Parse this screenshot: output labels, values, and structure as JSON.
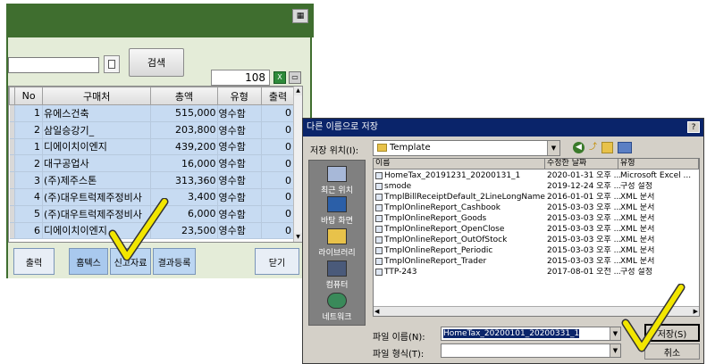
{
  "app": {
    "search_button": "검색",
    "record_count": "108",
    "grid": {
      "headers": [
        "No",
        "구매처",
        "총액",
        "유형",
        "출력"
      ],
      "rows": [
        {
          "no": "1",
          "name": "유에스건축",
          "amount": "515,000",
          "type": "영수함",
          "out": "0"
        },
        {
          "no": "2",
          "name": "삼일승강기_",
          "amount": "203,800",
          "type": "영수함",
          "out": "0"
        },
        {
          "no": "1",
          "name": "디에이치이엔지",
          "amount": "439,200",
          "type": "영수함",
          "out": "0"
        },
        {
          "no": "2",
          "name": "대구공업사",
          "amount": "16,000",
          "type": "영수함",
          "out": "0"
        },
        {
          "no": "3",
          "name": "(주)제주스톤",
          "amount": "313,360",
          "type": "영수함",
          "out": "0"
        },
        {
          "no": "4",
          "name": "(주)대우트럭제주정비사",
          "amount": "3,400",
          "type": "영수함",
          "out": "0"
        },
        {
          "no": "5",
          "name": "(주)대우트럭제주정비사",
          "amount": "6,000",
          "type": "영수함",
          "out": "0"
        },
        {
          "no": "6",
          "name": "디에이치이엔지",
          "amount": "23,500",
          "type": "영수함",
          "out": "0"
        }
      ]
    },
    "buttons": {
      "print": "출력",
      "hometax": "홈텍스",
      "report": "신고자료",
      "result": "결과등록",
      "close": "닫기"
    }
  },
  "dialog": {
    "title": "다른 이름으로 저장",
    "save_in_label": "저장 위치(I):",
    "save_in_value": "Template",
    "places": [
      "최근 위치",
      "바탕 화면",
      "라이브러리",
      "컴퓨터",
      "네트워크"
    ],
    "columns": [
      "이름",
      "수정한 날짜",
      "유형"
    ],
    "files": [
      {
        "name": "HomeTax_20191231_20200131_1",
        "date": "2020-01-31 오후 ...",
        "type": "Microsoft Excel ..."
      },
      {
        "name": "smode",
        "date": "2019-12-24 오후 ...",
        "type": "구성 설정"
      },
      {
        "name": "TmplBillReceiptDefault_2LineLongName",
        "date": "2016-01-01 오후 ...",
        "type": "XML 문서"
      },
      {
        "name": "TmplOnlineReport_Cashbook",
        "date": "2015-03-03 오후 ...",
        "type": "XML 문서"
      },
      {
        "name": "TmplOnlineReport_Goods",
        "date": "2015-03-03 오후 ...",
        "type": "XML 문서"
      },
      {
        "name": "TmplOnlineReport_OpenClose",
        "date": "2015-03-03 오후 ...",
        "type": "XML 문서"
      },
      {
        "name": "TmplOnlineReport_OutOfStock",
        "date": "2015-03-03 오후 ...",
        "type": "XML 문서"
      },
      {
        "name": "TmplOnlineReport_Periodic",
        "date": "2015-03-03 오후 ...",
        "type": "XML 문서"
      },
      {
        "name": "TmplOnlineReport_Trader",
        "date": "2015-03-03 오후 ...",
        "type": "XML 문서"
      },
      {
        "name": "TTP-243",
        "date": "2017-08-01 오전 ...",
        "type": "구성 설정"
      }
    ],
    "filename_label": "파일 이름(N):",
    "filename_value": "HomeTax_20200101_20200331_1",
    "filetype_label": "파일 형식(T):",
    "save_button": "저장(S)",
    "cancel_button": "취소"
  },
  "colors": {
    "app_title_green": "#3f6e2f",
    "grid_row_blue": "#c7dbf2",
    "dialog_title_blue": "#0a246a",
    "checkmark_yellow": "#f2e600"
  }
}
